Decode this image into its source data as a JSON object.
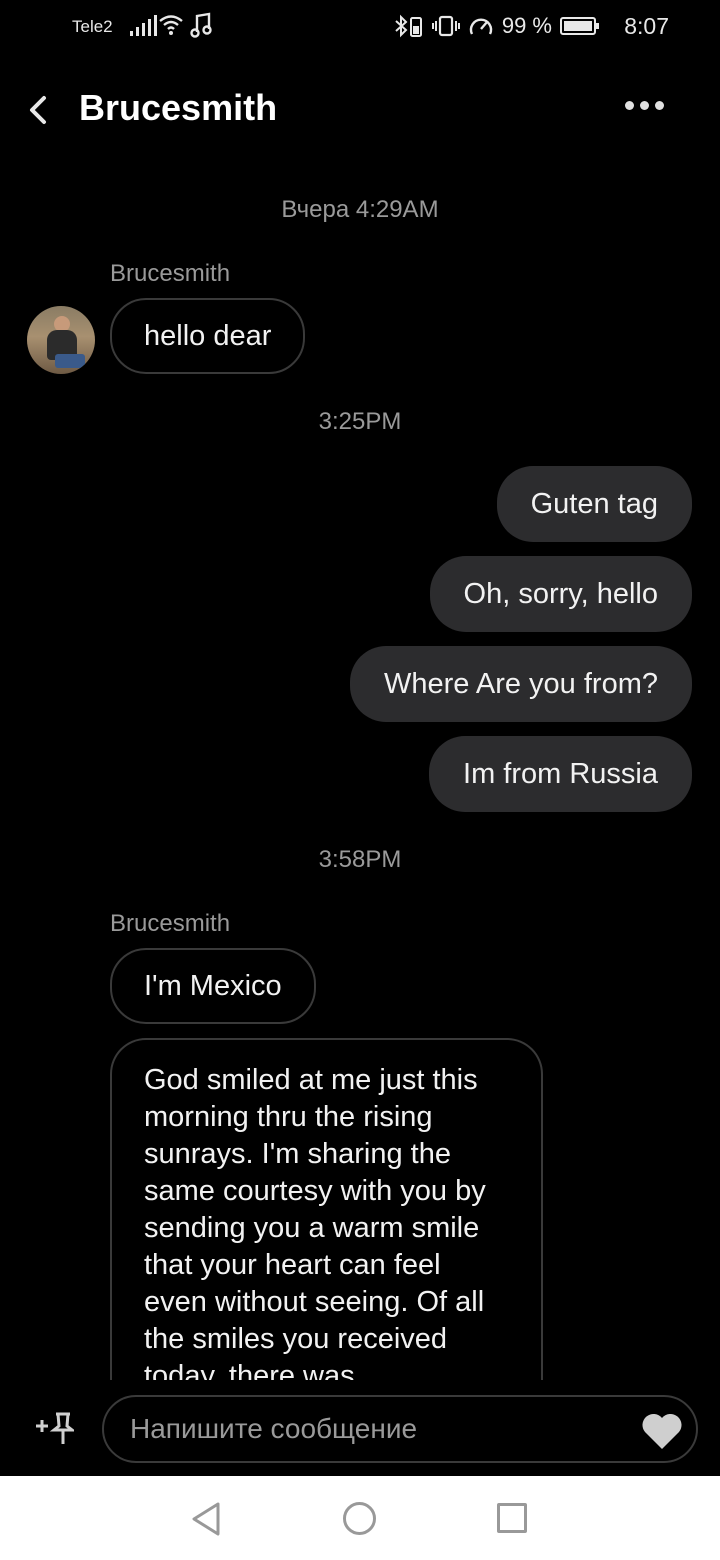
{
  "status_bar": {
    "carrier": "Tele2",
    "battery": "99 %",
    "battery_level": 0.99,
    "time": "8:07"
  },
  "header": {
    "title": "Brucesmith"
  },
  "messages": {
    "ts1": "Вчера 4:29AM",
    "sender1": "Brucesmith",
    "in1": "hello dear",
    "ts2": "3:25PM",
    "out1": "Guten tag",
    "out2": "Oh, sorry, hello",
    "out3": "Where Are you from?",
    "out4": "Im from Russia",
    "ts3": "3:58PM",
    "sender2": "Brucesmith",
    "in2": "I'm Mexico",
    "in3": "God smiled at me just this morning thru the rising sunrays. I'm sharing the same courtesy with you by sending you a warm smile that your heart can feel even without seeing. Of all the smiles you received today, there was"
  },
  "composer": {
    "placeholder": "Напишите сообщение"
  },
  "icons": {
    "back": "chevron-left-icon",
    "more": "more-dots-icon",
    "attach": "plus-pin-icon",
    "like": "heart-icon"
  }
}
